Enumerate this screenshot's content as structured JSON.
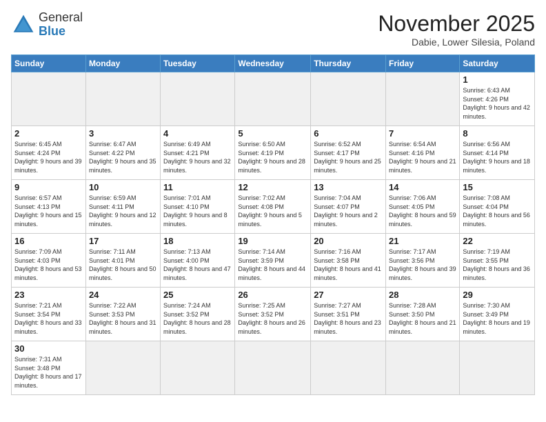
{
  "logo": {
    "general": "General",
    "blue": "Blue"
  },
  "header": {
    "title": "November 2025",
    "subtitle": "Dabie, Lower Silesia, Poland"
  },
  "weekdays": [
    "Sunday",
    "Monday",
    "Tuesday",
    "Wednesday",
    "Thursday",
    "Friday",
    "Saturday"
  ],
  "weeks": [
    [
      {
        "day": "",
        "info": ""
      },
      {
        "day": "",
        "info": ""
      },
      {
        "day": "",
        "info": ""
      },
      {
        "day": "",
        "info": ""
      },
      {
        "day": "",
        "info": ""
      },
      {
        "day": "",
        "info": ""
      },
      {
        "day": "1",
        "info": "Sunrise: 6:43 AM\nSunset: 4:26 PM\nDaylight: 9 hours\nand 42 minutes."
      }
    ],
    [
      {
        "day": "2",
        "info": "Sunrise: 6:45 AM\nSunset: 4:24 PM\nDaylight: 9 hours\nand 39 minutes."
      },
      {
        "day": "3",
        "info": "Sunrise: 6:47 AM\nSunset: 4:22 PM\nDaylight: 9 hours\nand 35 minutes."
      },
      {
        "day": "4",
        "info": "Sunrise: 6:49 AM\nSunset: 4:21 PM\nDaylight: 9 hours\nand 32 minutes."
      },
      {
        "day": "5",
        "info": "Sunrise: 6:50 AM\nSunset: 4:19 PM\nDaylight: 9 hours\nand 28 minutes."
      },
      {
        "day": "6",
        "info": "Sunrise: 6:52 AM\nSunset: 4:17 PM\nDaylight: 9 hours\nand 25 minutes."
      },
      {
        "day": "7",
        "info": "Sunrise: 6:54 AM\nSunset: 4:16 PM\nDaylight: 9 hours\nand 21 minutes."
      },
      {
        "day": "8",
        "info": "Sunrise: 6:56 AM\nSunset: 4:14 PM\nDaylight: 9 hours\nand 18 minutes."
      }
    ],
    [
      {
        "day": "9",
        "info": "Sunrise: 6:57 AM\nSunset: 4:13 PM\nDaylight: 9 hours\nand 15 minutes."
      },
      {
        "day": "10",
        "info": "Sunrise: 6:59 AM\nSunset: 4:11 PM\nDaylight: 9 hours\nand 12 minutes."
      },
      {
        "day": "11",
        "info": "Sunrise: 7:01 AM\nSunset: 4:10 PM\nDaylight: 9 hours\nand 8 minutes."
      },
      {
        "day": "12",
        "info": "Sunrise: 7:02 AM\nSunset: 4:08 PM\nDaylight: 9 hours\nand 5 minutes."
      },
      {
        "day": "13",
        "info": "Sunrise: 7:04 AM\nSunset: 4:07 PM\nDaylight: 9 hours\nand 2 minutes."
      },
      {
        "day": "14",
        "info": "Sunrise: 7:06 AM\nSunset: 4:05 PM\nDaylight: 8 hours\nand 59 minutes."
      },
      {
        "day": "15",
        "info": "Sunrise: 7:08 AM\nSunset: 4:04 PM\nDaylight: 8 hours\nand 56 minutes."
      }
    ],
    [
      {
        "day": "16",
        "info": "Sunrise: 7:09 AM\nSunset: 4:03 PM\nDaylight: 8 hours\nand 53 minutes."
      },
      {
        "day": "17",
        "info": "Sunrise: 7:11 AM\nSunset: 4:01 PM\nDaylight: 8 hours\nand 50 minutes."
      },
      {
        "day": "18",
        "info": "Sunrise: 7:13 AM\nSunset: 4:00 PM\nDaylight: 8 hours\nand 47 minutes."
      },
      {
        "day": "19",
        "info": "Sunrise: 7:14 AM\nSunset: 3:59 PM\nDaylight: 8 hours\nand 44 minutes."
      },
      {
        "day": "20",
        "info": "Sunrise: 7:16 AM\nSunset: 3:58 PM\nDaylight: 8 hours\nand 41 minutes."
      },
      {
        "day": "21",
        "info": "Sunrise: 7:17 AM\nSunset: 3:56 PM\nDaylight: 8 hours\nand 39 minutes."
      },
      {
        "day": "22",
        "info": "Sunrise: 7:19 AM\nSunset: 3:55 PM\nDaylight: 8 hours\nand 36 minutes."
      }
    ],
    [
      {
        "day": "23",
        "info": "Sunrise: 7:21 AM\nSunset: 3:54 PM\nDaylight: 8 hours\nand 33 minutes."
      },
      {
        "day": "24",
        "info": "Sunrise: 7:22 AM\nSunset: 3:53 PM\nDaylight: 8 hours\nand 31 minutes."
      },
      {
        "day": "25",
        "info": "Sunrise: 7:24 AM\nSunset: 3:52 PM\nDaylight: 8 hours\nand 28 minutes."
      },
      {
        "day": "26",
        "info": "Sunrise: 7:25 AM\nSunset: 3:52 PM\nDaylight: 8 hours\nand 26 minutes."
      },
      {
        "day": "27",
        "info": "Sunrise: 7:27 AM\nSunset: 3:51 PM\nDaylight: 8 hours\nand 23 minutes."
      },
      {
        "day": "28",
        "info": "Sunrise: 7:28 AM\nSunset: 3:50 PM\nDaylight: 8 hours\nand 21 minutes."
      },
      {
        "day": "29",
        "info": "Sunrise: 7:30 AM\nSunset: 3:49 PM\nDaylight: 8 hours\nand 19 minutes."
      }
    ],
    [
      {
        "day": "30",
        "info": "Sunrise: 7:31 AM\nSunset: 3:48 PM\nDaylight: 8 hours\nand 17 minutes."
      },
      {
        "day": "",
        "info": ""
      },
      {
        "day": "",
        "info": ""
      },
      {
        "day": "",
        "info": ""
      },
      {
        "day": "",
        "info": ""
      },
      {
        "day": "",
        "info": ""
      },
      {
        "day": "",
        "info": ""
      }
    ]
  ]
}
